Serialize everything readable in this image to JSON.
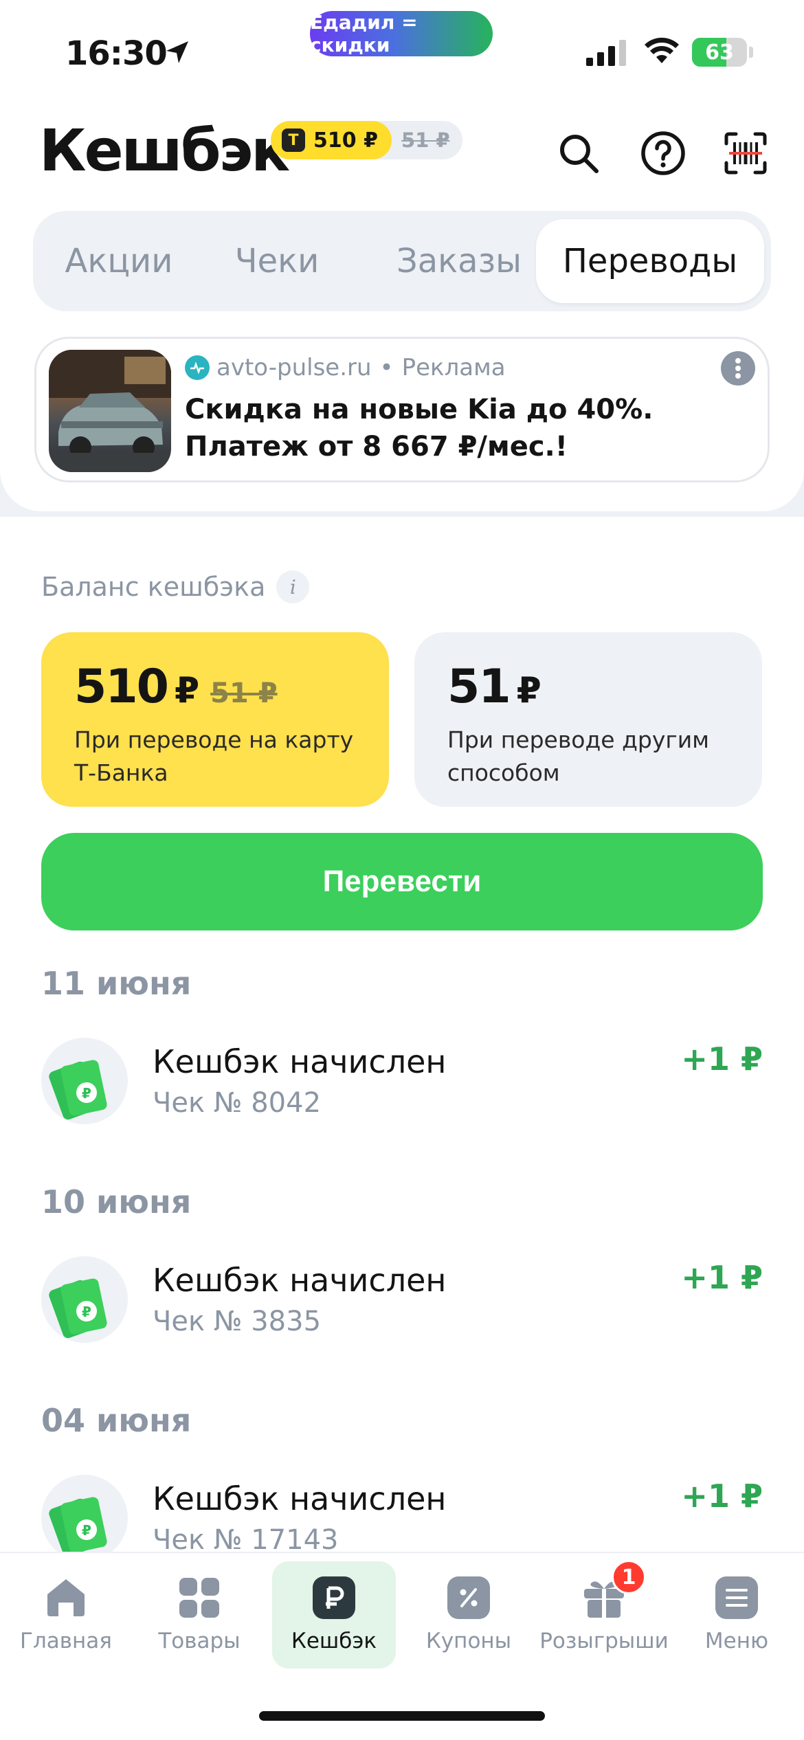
{
  "status_bar": {
    "time": "16:30",
    "promo": "Едадил = скидки",
    "battery": "63",
    "battery_level": 0.63
  },
  "header": {
    "title": "Кешбэк",
    "chip": {
      "badge": "Т",
      "tbank_amount": "510 ₽",
      "other_amount": "51 ₽"
    },
    "icons": [
      "search-icon",
      "help-icon",
      "scan-icon"
    ]
  },
  "tabs": [
    "Акции",
    "Чеки",
    "Заказы",
    "Переводы"
  ],
  "active_tab": "Переводы",
  "ad": {
    "source": "avto-pulse.ru",
    "separator": "•",
    "label": "Реклама",
    "text": "Скидка на новые Kia до 40%. Платеж от 8 667 ₽/мес.!"
  },
  "balance": {
    "label": "Баланс кешбэка",
    "info": "i",
    "tbank": {
      "amount": "510",
      "currency": "₽",
      "old": "51 ₽",
      "desc": "При переводе на карту Т-Банка"
    },
    "other": {
      "amount": "51",
      "currency": "₽",
      "desc": "При переводе другим способом"
    },
    "button": "Перевести"
  },
  "history": [
    {
      "date": "11 июня",
      "title": "Кешбэк начислен",
      "sub": "Чек № 8042",
      "amount": "+1 ₽"
    },
    {
      "date": "10 июня",
      "title": "Кешбэк начислен",
      "sub": "Чек № 3835",
      "amount": "+1 ₽"
    },
    {
      "date": "04 июня",
      "title": "Кешбэк начислен",
      "sub": "Чек № 17143",
      "amount": "+1 ₽"
    }
  ],
  "nav": [
    {
      "label": "Главная",
      "icon": "home-icon"
    },
    {
      "label": "Товары",
      "icon": "grid-icon"
    },
    {
      "label": "Кешбэк",
      "icon": "ruble-icon",
      "active": true
    },
    {
      "label": "Купоны",
      "icon": "percent-icon"
    },
    {
      "label": "Розыгрыши",
      "icon": "gift-icon",
      "badge": "1"
    },
    {
      "label": "Меню",
      "icon": "menu-icon"
    }
  ],
  "colors": {
    "accent_green": "#3ccf5c",
    "tbank_yellow": "#ffdd2d",
    "amount_green": "#2ea653",
    "muted": "#8b95a3"
  }
}
